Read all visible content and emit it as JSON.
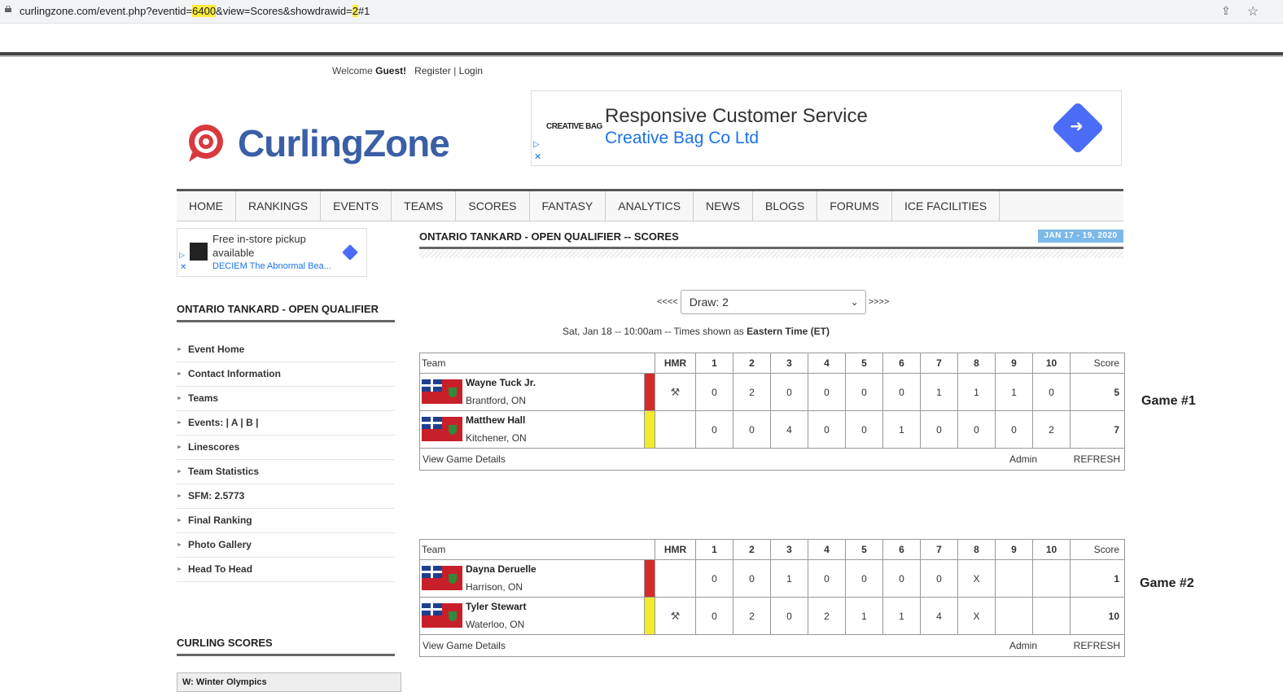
{
  "browser": {
    "url_prefix": "curlingzone.com/event.php?eventid=",
    "url_eventid": "6400",
    "url_middle": "&view=Scores&showdrawid=",
    "url_drawid": "2",
    "url_suffix": "#1"
  },
  "header": {
    "welcome": "Welcome",
    "guest": "Guest!",
    "register": "Register",
    "sep": "|",
    "login": "Login",
    "logo_curling": "Curling",
    "logo_zone": "Zone"
  },
  "ad_top": {
    "brand": "CREATIVE BAG",
    "title": "Responsive Customer Service",
    "subtitle": "Creative Bag Co Ltd"
  },
  "nav": [
    "HOME",
    "RANKINGS",
    "EVENTS",
    "TEAMS",
    "SCORES",
    "FANTASY",
    "ANALYTICS",
    "NEWS",
    "BLOGS",
    "FORUMS",
    "ICE FACILITIES"
  ],
  "ad_side": {
    "line1": "Free in-store pickup",
    "line2": "available",
    "line3": "DECIEM The Abnormal Bea..."
  },
  "sidebar": {
    "heading": "ONTARIO TANKARD - OPEN QUALIFIER",
    "items": [
      "Event Home",
      "Contact Information",
      "Teams",
      "Events: | A | B |",
      "Linescores",
      "Team Statistics",
      "SFM: 2.5773",
      "Final Ranking",
      "Photo Gallery",
      "Head To Head"
    ],
    "scores_heading": "CURLING SCORES",
    "scores_box": "W: Winter Olympics"
  },
  "main": {
    "title": "ONTARIO TANKARD - OPEN QUALIFIER -- SCORES",
    "date_badge": "JAN 17 - 19, 2020",
    "prev": "<<<<",
    "next": ">>>>",
    "draw_select": "Draw: 2",
    "time_prefix": "Sat, Jan 18 -- 10:00am -- Times shown as",
    "time_zone": "Eastern Time (ET)"
  },
  "table_headers": {
    "team": "Team",
    "hmr": "HMR",
    "ends": [
      "1",
      "2",
      "3",
      "4",
      "5",
      "6",
      "7",
      "8",
      "9",
      "10"
    ],
    "score": "Score"
  },
  "footer_links": {
    "details": "View Game Details",
    "admin": "Admin",
    "refresh": "REFRESH"
  },
  "games": [
    {
      "label": "Game #1",
      "teams": [
        {
          "name": "Wayne Tuck Jr.",
          "location": "Brantford, ON",
          "color": "#d42a2a",
          "hammer": true,
          "ends": [
            "0",
            "2",
            "0",
            "0",
            "0",
            "0",
            "1",
            "1",
            "1",
            "0"
          ],
          "score": "5"
        },
        {
          "name": "Matthew Hall",
          "location": "Kitchener, ON",
          "color": "#f2ea2a",
          "hammer": false,
          "ends": [
            "0",
            "0",
            "4",
            "0",
            "0",
            "1",
            "0",
            "0",
            "0",
            "2"
          ],
          "score": "7"
        }
      ]
    },
    {
      "label": "Game #2",
      "teams": [
        {
          "name": "Dayna Deruelle",
          "location": "Harrison, ON",
          "color": "#d42a2a",
          "hammer": false,
          "ends": [
            "0",
            "0",
            "1",
            "0",
            "0",
            "0",
            "0",
            "X",
            "",
            ""
          ],
          "score": "1"
        },
        {
          "name": "Tyler Stewart",
          "location": "Waterloo, ON",
          "color": "#f2ea2a",
          "hammer": true,
          "ends": [
            "0",
            "2",
            "0",
            "2",
            "1",
            "1",
            "4",
            "X",
            "",
            ""
          ],
          "score": "10"
        }
      ]
    }
  ]
}
